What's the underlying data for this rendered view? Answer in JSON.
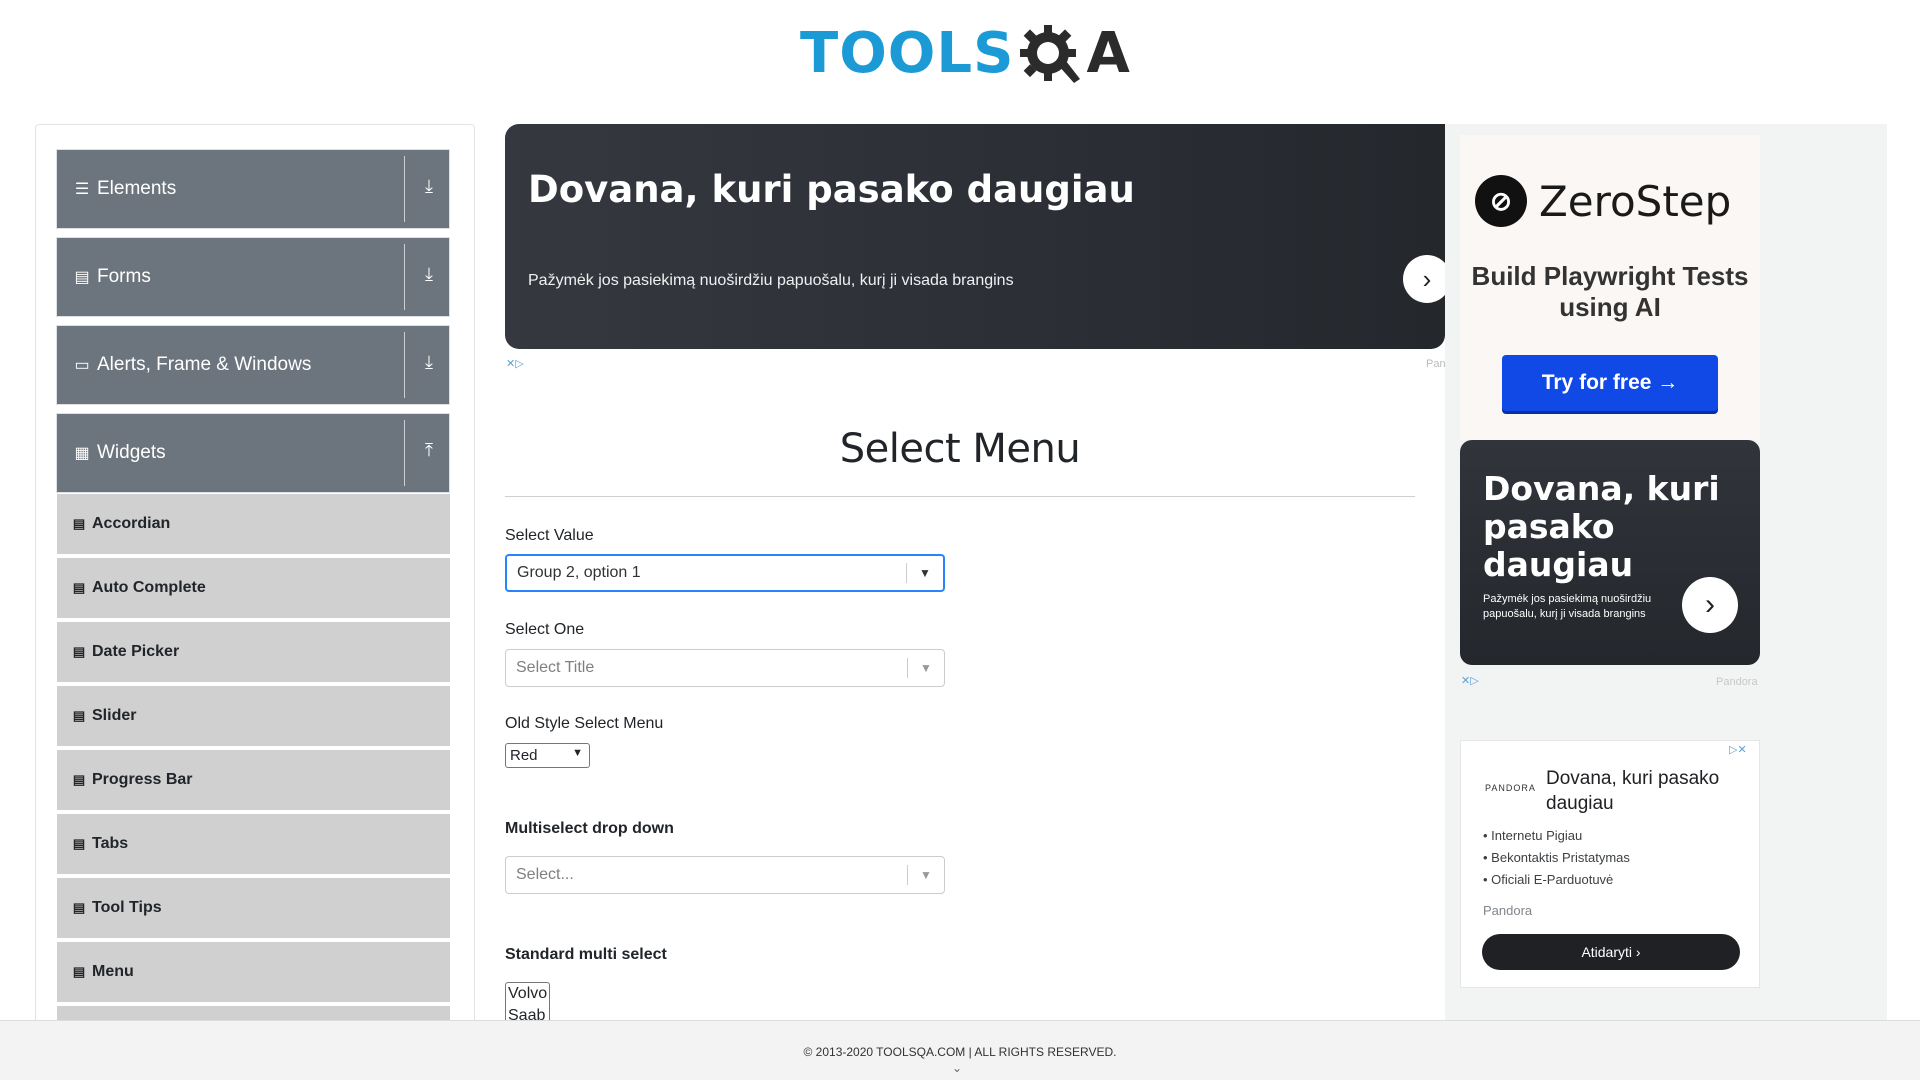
{
  "logo": {
    "part1": "TOOLS",
    "part2": "A"
  },
  "sidebar": {
    "groups": [
      {
        "label": "Elements",
        "icon": "menu-lines-icon",
        "arrow": "⤓"
      },
      {
        "label": "Forms",
        "icon": "document-icon",
        "arrow": "⤓"
      },
      {
        "label": "Alerts, Frame & Windows",
        "icon": "window-icon",
        "arrow": "⤓"
      },
      {
        "label": "Widgets",
        "icon": "grid-icon",
        "arrow": "⤒"
      }
    ],
    "items": [
      {
        "label": "Accordian"
      },
      {
        "label": "Auto Complete"
      },
      {
        "label": "Date Picker"
      },
      {
        "label": "Slider"
      },
      {
        "label": "Progress Bar"
      },
      {
        "label": "Tabs"
      },
      {
        "label": "Tool Tips"
      },
      {
        "label": "Menu"
      }
    ]
  },
  "banner_ad": {
    "title": "Dovana, kuri pasako daugiau",
    "subtitle": "Pažymėk jos pasiekimą nuoširdžiu papuošalu, kurį ji visada brangins",
    "source": "Pan"
  },
  "main": {
    "title": "Select Menu",
    "select_value": {
      "label": "Select Value",
      "value": "Group 2, option 1"
    },
    "select_one": {
      "label": "Select One",
      "placeholder": "Select Title"
    },
    "old_style": {
      "label": "Old Style Select Menu",
      "value": "Red"
    },
    "multiselect": {
      "label": "Multiselect drop down",
      "placeholder": "Select..."
    },
    "standard_multi": {
      "label": "Standard multi select",
      "options": [
        "Volvo",
        "Saab"
      ]
    }
  },
  "right_ads": {
    "zerostep": {
      "name": "ZeroStep",
      "tagline": "Build Playwright Tests using AI",
      "button": "Try for free →"
    },
    "pandora1": {
      "title": "Dovana, kuri pasako daugiau",
      "subtitle": "Pažymėk jos pasiekimą nuoširdžiu papuošalu, kurį ji visada brangins",
      "source": "Pandora"
    },
    "pandora2": {
      "brand": "PANDORA",
      "title": "Dovana, kuri pasako daugiau",
      "bullets": [
        "Internetu Pigiau",
        "Bekontaktis Pristatymas",
        "Oficiali E-Parduotuvė"
      ],
      "source": "Pandora",
      "button": "Atidaryti ›"
    }
  },
  "footer": {
    "copyright": "© 2013-2020 TOOLSQA.COM | ALL RIGHTS RESERVED."
  },
  "colors": {
    "accent": "#1b9ad6",
    "sidebar_group": "#6c757d",
    "focus": "#2684ff"
  }
}
